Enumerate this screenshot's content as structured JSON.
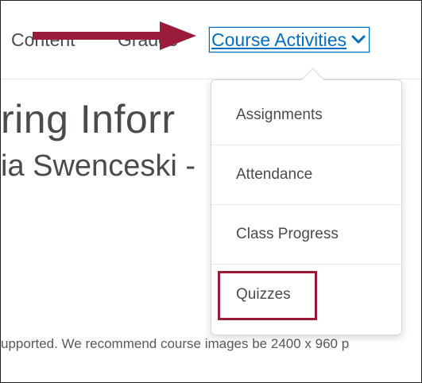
{
  "navbar": {
    "items": [
      {
        "label": "Content"
      },
      {
        "label": "Grades"
      }
    ],
    "active_item": {
      "label": "Course Activities",
      "icon": "chevron-down-icon"
    }
  },
  "page": {
    "heading": "ring Inforr",
    "subheading": "ia Swenceski -",
    "note": "upported. We recommend course images be 2400 x 960 p"
  },
  "dropdown": {
    "items": [
      {
        "label": "Assignments"
      },
      {
        "label": "Attendance"
      },
      {
        "label": "Class Progress"
      },
      {
        "label": "Quizzes"
      }
    ]
  },
  "annotations": {
    "arrow_color": "#9b1b3a",
    "highlight_color": "#9b1b3a",
    "highlighted_item": "Quizzes"
  },
  "colors": {
    "link": "#006fbf",
    "text": "#494c4e"
  }
}
